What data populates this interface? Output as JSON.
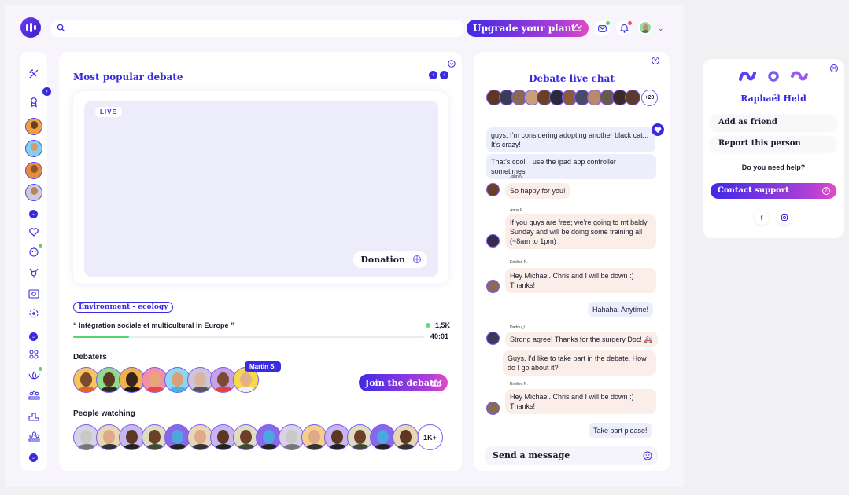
{
  "header": {
    "search_placeholder": "",
    "upgrade_label": "Upgrade your plan!"
  },
  "main": {
    "title": "Most popular debate",
    "live_badge": "LIVE",
    "donation_label": "Donation",
    "category_tag": "Environment - ecology",
    "debate_title": "“ Intégration sociale et multicultural in Europe ”",
    "viewers": "1,5K",
    "timer": "40:01",
    "progress": 0.16,
    "debaters_label": "Debaters",
    "highlight_name": "Martin S.",
    "join_label": "Join the debate!",
    "watching_label": "People watching",
    "more_watching": "1K+"
  },
  "chat": {
    "title": "Debate live chat",
    "more_participants": "+20",
    "messages": [
      {
        "text": "guys, I’m considering adopting another black cat... It’s crazy!"
      },
      {
        "text": "That’s cool, i use the ipad app controller sometimes"
      },
      {
        "sender": "John N.",
        "text": "So happy for you!"
      },
      {
        "sender": "Anna F.",
        "text": "If you guys are free; we’re going to mt baldy Sunday and will be doing some training all (~8am to 1pm)"
      },
      {
        "sender": "Emilien N.",
        "text": "Hey Michael. Chris and I will be down :) Thanks!"
      },
      {
        "text": "Hahaha. Anytime!"
      },
      {
        "sender": "Dadou_U",
        "text": "Strong agree! Thanks for the surgery Doc! 🚑"
      },
      {
        "text": "Guys, I’d like to take part in the debate. How do I go about it?"
      },
      {
        "sender": "Emilien N.",
        "text": "Hey Michael. Chris and I will be down :) Thanks!"
      },
      {
        "text": "Take part please!"
      }
    ],
    "send_placeholder": "Send a message"
  },
  "profile": {
    "name": "Raphaël Held",
    "add_friend": "Add as friend",
    "report": "Report this person",
    "help": "Do you need help?",
    "contact": "Contact support"
  },
  "colors": {
    "accent": "#3a2be0",
    "gradient_end": "#e04bc6",
    "live_green": "#58d46f"
  }
}
